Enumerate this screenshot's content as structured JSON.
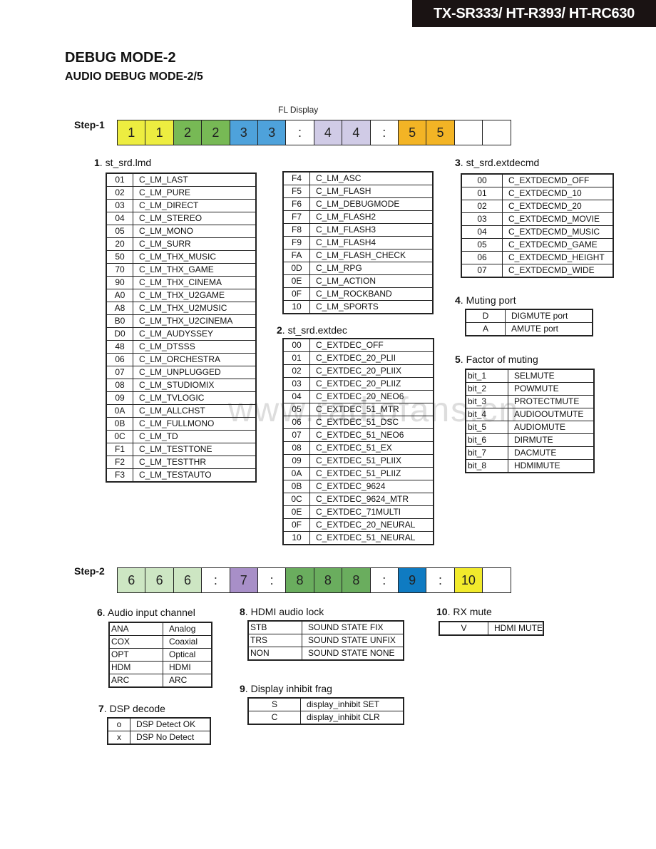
{
  "header": {
    "model": "TX-SR333/ HT-R393/ HT-RC630"
  },
  "title": "DEBUG MODE-2",
  "subtitle": "AUDIO DEBUG MODE-2/5",
  "watermark": "www.radiofans.cn",
  "fl_display_label": "FL Display",
  "step1": {
    "label": "Step-1",
    "cells": [
      {
        "text": "1",
        "color": "#eded40"
      },
      {
        "text": "1",
        "color": "#eded40"
      },
      {
        "text": "2",
        "color": "#77b955"
      },
      {
        "text": "2",
        "color": "#77b955"
      },
      {
        "text": "3",
        "color": "#4ea2db"
      },
      {
        "text": "3",
        "color": "#4ea2db"
      },
      {
        "text": ":",
        "color": "#ffffff"
      },
      {
        "text": "4",
        "color": "#d0cbe6"
      },
      {
        "text": "4",
        "color": "#d0cbe6"
      },
      {
        "text": ":",
        "color": "#ffffff"
      },
      {
        "text": "5",
        "color": "#f3b425"
      },
      {
        "text": "5",
        "color": "#f3b425"
      },
      {
        "text": "",
        "color": "#ffffff"
      },
      {
        "text": "",
        "color": "#ffffff"
      }
    ]
  },
  "step2": {
    "label": "Step-2",
    "cells": [
      {
        "text": "6",
        "color": "#cde6c3"
      },
      {
        "text": "6",
        "color": "#cde6c3"
      },
      {
        "text": "6",
        "color": "#cde6c3"
      },
      {
        "text": ":",
        "color": "#ffffff"
      },
      {
        "text": "7",
        "color": "#a88fc8"
      },
      {
        "text": ":",
        "color": "#ffffff"
      },
      {
        "text": "8",
        "color": "#6aad5e"
      },
      {
        "text": "8",
        "color": "#6aad5e"
      },
      {
        "text": "8",
        "color": "#6aad5e"
      },
      {
        "text": ":",
        "color": "#ffffff"
      },
      {
        "text": "9",
        "color": "#0f7bc2"
      },
      {
        "text": ":",
        "color": "#ffffff"
      },
      {
        "text": "10",
        "color": "#f1ea2c"
      },
      {
        "text": "",
        "color": "#ffffff"
      }
    ]
  },
  "sections": {
    "s1": {
      "num": "1",
      "title": "st_srd.lmd",
      "rows_a": [
        [
          "01",
          "C_LM_LAST"
        ],
        [
          "02",
          "C_LM_PURE"
        ],
        [
          "03",
          "C_LM_DIRECT"
        ],
        [
          "04",
          "C_LM_STEREO"
        ],
        [
          "05",
          "C_LM_MONO"
        ],
        [
          "20",
          "C_LM_SURR"
        ],
        [
          "50",
          "C_LM_THX_MUSIC"
        ],
        [
          "70",
          "C_LM_THX_GAME"
        ],
        [
          "90",
          "C_LM_THX_CINEMA"
        ],
        [
          "A0",
          "C_LM_THX_U2GAME"
        ],
        [
          "A8",
          "C_LM_THX_U2MUSIC"
        ],
        [
          "B0",
          "C_LM_THX_U2CINEMA"
        ],
        [
          "D0",
          "C_LM_AUDYSSEY"
        ],
        [
          "48",
          "C_LM_DTSSS"
        ],
        [
          "06",
          "C_LM_ORCHESTRA"
        ],
        [
          "07",
          "C_LM_UNPLUGGED"
        ],
        [
          "08",
          "C_LM_STUDIOMIX"
        ],
        [
          "09",
          "C_LM_TVLOGIC"
        ],
        [
          "0A",
          "C_LM_ALLCHST"
        ],
        [
          "0B",
          "C_LM_FULLMONO"
        ],
        [
          "0C",
          "C_LM_TD"
        ],
        [
          "F1",
          "C_LM_TESTTONE"
        ],
        [
          "F2",
          "C_LM_TESTTHR"
        ],
        [
          "F3",
          "C_LM_TESTAUTO"
        ]
      ],
      "rows_b": [
        [
          "F4",
          "C_LM_ASC"
        ],
        [
          "F5",
          "C_LM_FLASH"
        ],
        [
          "F6",
          "C_LM_DEBUGMODE"
        ],
        [
          "F7",
          "C_LM_FLASH2"
        ],
        [
          "F8",
          "C_LM_FLASH3"
        ],
        [
          "F9",
          "C_LM_FLASH4"
        ],
        [
          "FA",
          "C_LM_FLASH_CHECK"
        ],
        [
          "0D",
          "C_LM_RPG"
        ],
        [
          "0E",
          "C_LM_ACTION"
        ],
        [
          "0F",
          "C_LM_ROCKBAND"
        ],
        [
          "10",
          "C_LM_SPORTS"
        ]
      ]
    },
    "s2": {
      "num": "2",
      "title": "st_srd.extdec",
      "rows": [
        [
          "00",
          "C_EXTDEC_OFF"
        ],
        [
          "01",
          "C_EXTDEC_20_PLII"
        ],
        [
          "02",
          "C_EXTDEC_20_PLIIX"
        ],
        [
          "03",
          "C_EXTDEC_20_PLIIZ"
        ],
        [
          "04",
          "C_EXTDEC_20_NEO6"
        ],
        [
          "05",
          "C_EXTDEC_51_MTR"
        ],
        [
          "06",
          "C_EXTDEC_51_DSC"
        ],
        [
          "07",
          "C_EXTDEC_51_NEO6"
        ],
        [
          "08",
          "C_EXTDEC_51_EX"
        ],
        [
          "09",
          "C_EXTDEC_51_PLIIX"
        ],
        [
          "0A",
          "C_EXTDEC_51_PLIIZ"
        ],
        [
          "0B",
          "C_EXTDEC_9624"
        ],
        [
          "0C",
          "C_EXTDEC_9624_MTR"
        ],
        [
          "0E",
          "C_EXTDEC_71MULTI"
        ],
        [
          "0F",
          "C_EXTDEC_20_NEURAL"
        ],
        [
          "10",
          "C_EXTDEC_51_NEURAL"
        ]
      ]
    },
    "s3": {
      "num": "3",
      "title": "st_srd.extdecmd",
      "rows": [
        [
          "00",
          "C_EXTDECMD_OFF"
        ],
        [
          "01",
          "C_EXTDECMD_10"
        ],
        [
          "02",
          "C_EXTDECMD_20"
        ],
        [
          "03",
          "C_EXTDECMD_MOVIE"
        ],
        [
          "04",
          "C_EXTDECMD_MUSIC"
        ],
        [
          "05",
          "C_EXTDECMD_GAME"
        ],
        [
          "06",
          "C_EXTDECMD_HEIGHT"
        ],
        [
          "07",
          "C_EXTDECMD_WIDE"
        ]
      ]
    },
    "s4": {
      "num": "4",
      "title": "Muting port",
      "rows": [
        [
          "D",
          "DIGMUTE port"
        ],
        [
          "A",
          "AMUTE port"
        ]
      ]
    },
    "s5": {
      "num": "5",
      "title": "Factor of muting",
      "rows": [
        [
          "bit_1",
          "SELMUTE"
        ],
        [
          "bit_2",
          "POWMUTE"
        ],
        [
          "bit_3",
          "PROTECTMUTE"
        ],
        [
          "bit_4",
          "AUDIOOUTMUTE"
        ],
        [
          "bit_5",
          "AUDIOMUTE"
        ],
        [
          "bit_6",
          "DIRMUTE"
        ],
        [
          "bit_7",
          "DACMUTE"
        ],
        [
          "bit_8",
          "HDMIMUTE"
        ]
      ]
    },
    "s6": {
      "num": "6",
      "title": "Audio input channel",
      "rows": [
        [
          "ANA",
          "Analog"
        ],
        [
          "COX",
          "Coaxial"
        ],
        [
          "OPT",
          "Optical"
        ],
        [
          "HDM",
          "HDMI"
        ],
        [
          "ARC",
          "ARC"
        ]
      ]
    },
    "s7": {
      "num": "7",
      "title": "DSP decode",
      "rows": [
        [
          "o",
          "DSP Detect OK"
        ],
        [
          "x",
          "DSP No Detect"
        ]
      ]
    },
    "s8": {
      "num": "8",
      "title": "HDMI audio lock",
      "rows": [
        [
          "STB",
          "SOUND STATE FIX"
        ],
        [
          "TRS",
          "SOUND STATE UNFIX"
        ],
        [
          "NON",
          "SOUND STATE NONE"
        ]
      ]
    },
    "s9": {
      "num": "9",
      "title": "Display inhibit frag",
      "rows": [
        [
          "S",
          "display_inhibit SET"
        ],
        [
          "C",
          "display_inhibit CLR"
        ]
      ]
    },
    "s10": {
      "num": "10",
      "title": "RX mute",
      "rows": [
        [
          "V",
          "HDMI MUTE"
        ]
      ]
    }
  }
}
